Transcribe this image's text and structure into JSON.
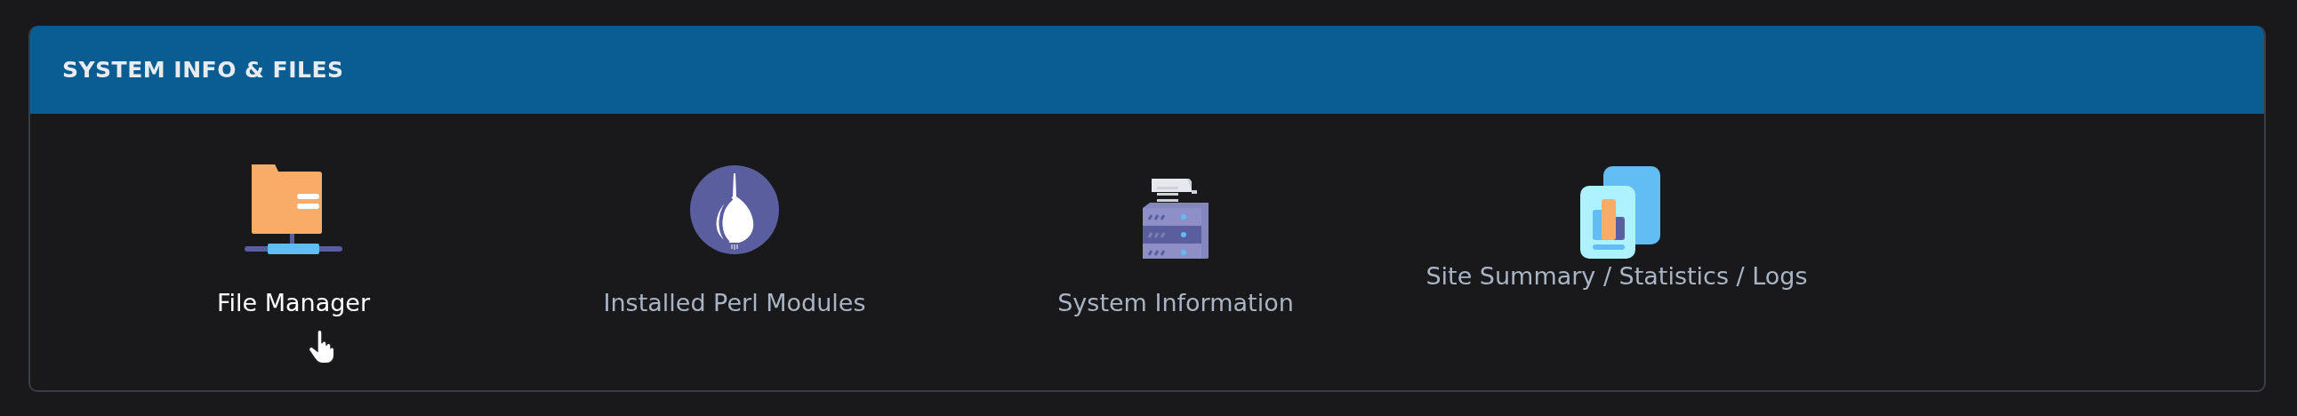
{
  "panel": {
    "title": "SYSTEM INFO & FILES"
  },
  "items": [
    {
      "kind": "folder",
      "label": "File Manager",
      "hovered": true
    },
    {
      "kind": "onion",
      "label": "Installed Perl Modules",
      "hovered": false
    },
    {
      "kind": "server",
      "label": "System Information",
      "hovered": false
    },
    {
      "kind": "report",
      "label": "Site Summary / Statistics / Logs",
      "hovered": false
    }
  ]
}
